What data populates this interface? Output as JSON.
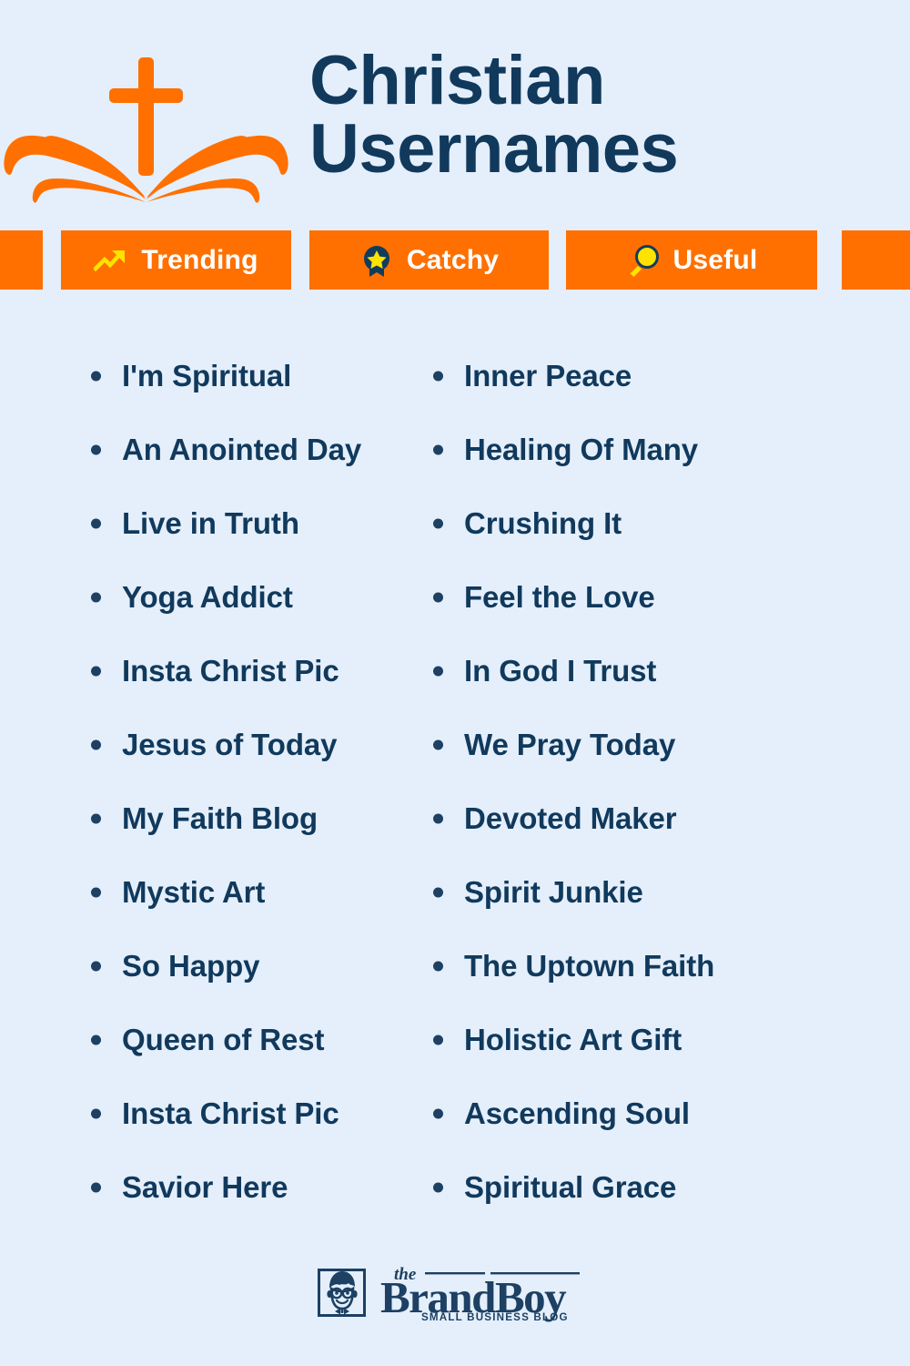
{
  "header": {
    "title_line1": "Christian",
    "title_line2": "Usernames",
    "icon": "cross-open-book-icon"
  },
  "colors": {
    "background": "#e4effb",
    "accent_orange": "#ff7000",
    "navy": "#11395c",
    "yellow": "#ffe300",
    "white": "#ffffff"
  },
  "tags": [
    {
      "label": "Trending",
      "icon": "trending-up-icon"
    },
    {
      "label": "Catchy",
      "icon": "award-badge-star-icon"
    },
    {
      "label": "Useful",
      "icon": "magnifying-glass-icon"
    }
  ],
  "columns": {
    "left": [
      "I'm Spiritual",
      "An Anointed Day",
      "Live in Truth",
      "Yoga Addict",
      "Insta Christ Pic",
      "Jesus of Today",
      "My Faith Blog",
      "Mystic Art",
      "So Happy",
      "Queen of Rest",
      "Insta Christ Pic",
      "Savior Here"
    ],
    "right": [
      "Inner Peace",
      "Healing Of Many",
      "Crushing It",
      "Feel the Love",
      "In God I Trust",
      "We Pray Today",
      "Devoted Maker",
      "Spirit Junkie",
      "The Uptown Faith",
      "Holistic Art Gift",
      "Ascending Soul",
      "Spiritual Grace"
    ]
  },
  "footer": {
    "logo_the": "the",
    "logo_brand": "Brand",
    "logo_boy": "Boy",
    "logo_tagline": "SMALL BUSINESS BLOG",
    "logo_mark": "brandboy-face-icon"
  }
}
